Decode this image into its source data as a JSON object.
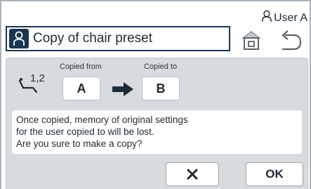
{
  "header": {
    "user_label": "User A",
    "title": "Copy of chair preset"
  },
  "dialog": {
    "chair_memory_label": "1,2",
    "copied_from_label": "Copied from",
    "copied_to_label": "Copied to",
    "copied_from_value": "A",
    "copied_to_value": "B",
    "message_lines": [
      "Once copied, memory of original settings",
      "for the user copied to will be lost.",
      "Are you sure to make a copy?"
    ],
    "ok_label": "OK"
  },
  "icons": {
    "user": "user-icon",
    "home": "home-icon",
    "back": "back-arrow-icon",
    "chair": "chair-icon",
    "arrow": "right-arrow-icon",
    "cancel": "close-icon"
  },
  "colors": {
    "accent": "#1a3550",
    "dialog_bg": "#d7dbde",
    "text": "#1e2a35"
  }
}
